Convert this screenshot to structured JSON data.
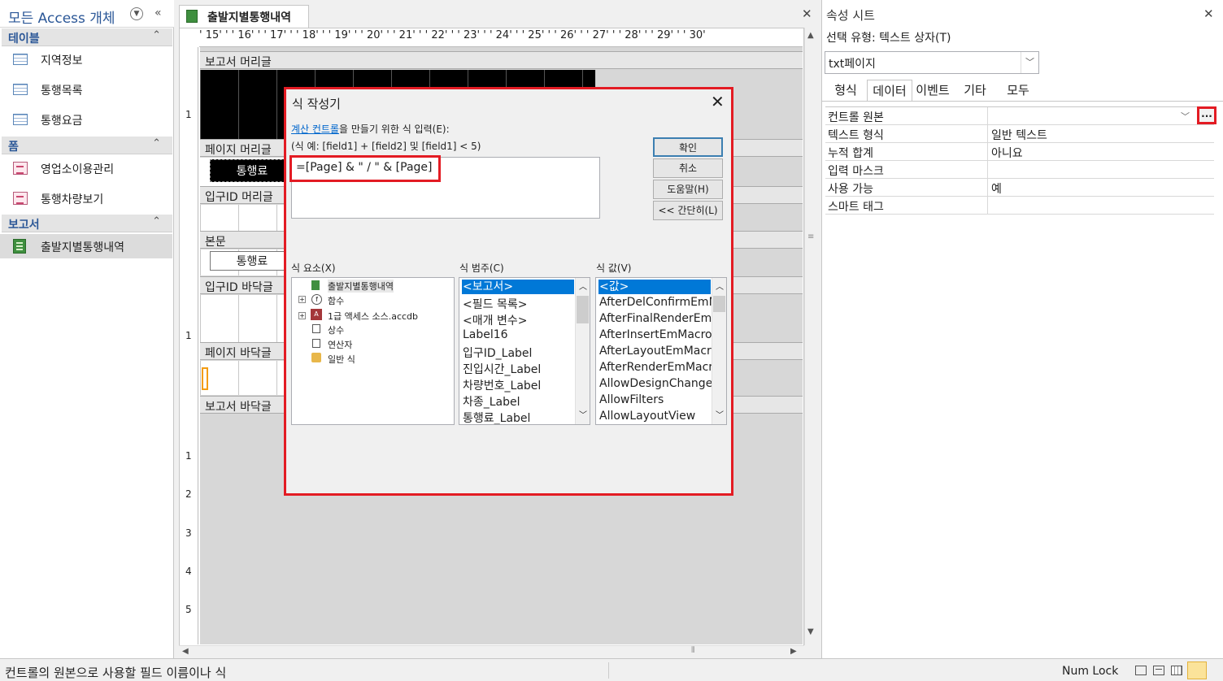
{
  "nav": {
    "title": "모든 Access 개체",
    "groups": {
      "tables": "테이블",
      "forms": "폼",
      "reports": "보고서"
    },
    "tables": [
      "지역정보",
      "통행목록",
      "통행요금"
    ],
    "forms": [
      "영업소이용관리",
      "통행차량보기"
    ],
    "reports": [
      "출발지별통행내역"
    ]
  },
  "document": {
    "tab_label": "출발지별통행내역",
    "ruler": "' 15' ' ' 16' ' ' 17' ' ' 18' ' ' 19' ' ' 20' ' ' 21' ' ' 22' ' ' 23' ' ' 24' ' ' 25' ' ' 26' ' ' 27' ' ' 28' ' ' 29' ' ' 30'",
    "sections": {
      "report_header": "보고서 머리글",
      "page_header": "페이지 머리글",
      "group_header": "입구ID 머리글",
      "detail": "본문",
      "group_footer": "입구ID 바닥글",
      "page_footer": "페이지 바닥글",
      "report_footer": "보고서 바닥글"
    },
    "controls": {
      "header_label": "통행료",
      "detail_field": "통행료"
    },
    "vruler_marks": [
      "1",
      "1",
      "1",
      "2",
      "3",
      "4",
      "5"
    ]
  },
  "property_sheet": {
    "title": "속성 시트",
    "selection_type": "선택 유형: 텍스트 상자(T)",
    "object_combo": "txt페이지",
    "tabs": [
      "형식",
      "데이터",
      "이벤트",
      "기타",
      "모두"
    ],
    "active_tab": "데이터",
    "rows": [
      {
        "key": "컨트롤 원본",
        "value": ""
      },
      {
        "key": "텍스트 형식",
        "value": "일반 텍스트"
      },
      {
        "key": "누적 합계",
        "value": "아니요"
      },
      {
        "key": "입력 마스크",
        "value": ""
      },
      {
        "key": "사용 가능",
        "value": "예"
      },
      {
        "key": "스마트 태그",
        "value": ""
      }
    ],
    "builder_button": "..."
  },
  "dialog": {
    "title": "식 작성기",
    "instruction_link": "계산 컨트롤",
    "instruction_rest": "을 만들기 위한 식 입력(E):",
    "example": "(식 예: [field1] + [field2] 및 [field1] < 5)",
    "expression": "=[Page] & \" / \" & [Page]",
    "buttons": {
      "ok": "확인",
      "cancel": "취소",
      "help": "도움말(H)",
      "less": "<< 간단히(L)"
    },
    "elements_label": "식 요소(X)",
    "categories_label": "식 범주(C)",
    "values_label": "식 값(V)",
    "elements": [
      "출발지별통행내역",
      "함수",
      "1급 액세스 소스.accdb",
      "상수",
      "연산자",
      "일반 식"
    ],
    "categories": [
      "<보고서>",
      "<필드 목록>",
      "<매개 변수>",
      "Label16",
      "입구ID_Label",
      "진입시간_Label",
      "차량번호_Label",
      "차종_Label",
      "통행료_Label"
    ],
    "values": [
      "<값>",
      "AfterDelConfirmEmM",
      "AfterFinalRenderEmM",
      "AfterInsertEmMacro",
      "AfterLayoutEmMacro",
      "AfterRenderEmMacr",
      "AllowDesignChange",
      "AllowFilters",
      "AllowLayoutView"
    ]
  },
  "status": {
    "message": "컨트롤의 원본으로 사용할 필드 이름이나 식",
    "numlock": "Num Lock"
  }
}
